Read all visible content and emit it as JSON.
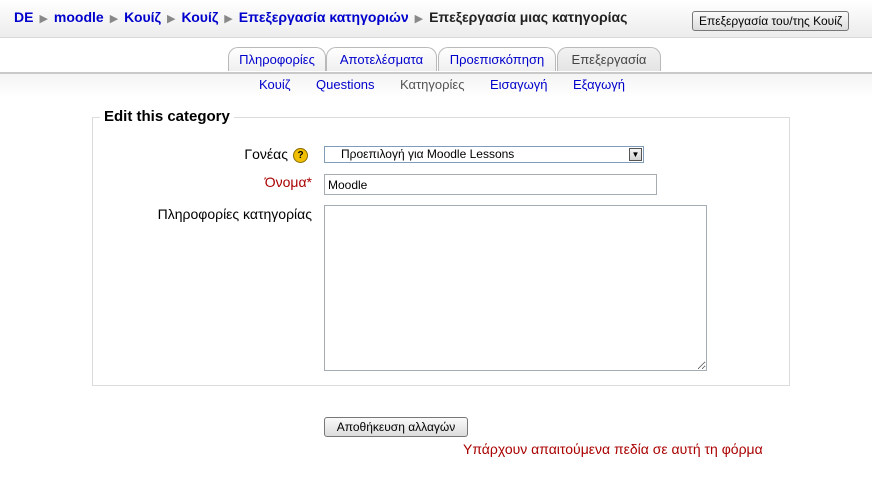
{
  "breadcrumb": {
    "items": [
      "DE",
      "moodle",
      "Κουίζ",
      "Κουίζ",
      "Επεξεργασία κατηγοριών"
    ],
    "current": "Επεξεργασία μιας κατηγορίας"
  },
  "header": {
    "edit_quiz_button": "Επεξεργασία του/της Κουίζ"
  },
  "tabs": [
    {
      "label": "Πληροφορίες"
    },
    {
      "label": "Αποτελέσματα"
    },
    {
      "label": "Προεπισκόπηση"
    },
    {
      "label": "Επεξεργασία",
      "selected": true
    }
  ],
  "subtabs": [
    {
      "label": "Κουίζ"
    },
    {
      "label": "Questions"
    },
    {
      "label": "Κατηγορίες",
      "selected": true
    },
    {
      "label": "Εισαγωγή"
    },
    {
      "label": "Εξαγωγή"
    }
  ],
  "form": {
    "legend": "Edit this category",
    "parent_label": "Γονέας",
    "parent_value": "Προεπιλογή για Moodle Lessons",
    "name_label": "Όνομα*",
    "name_value": "Moodle",
    "info_label": "Πληροφορίες κατηγορίας",
    "info_value": "",
    "save_button": "Αποθήκευση αλλαγών",
    "required_note": "Υπάρχουν απαιτούμενα πεδία σε αυτή τη φόρμα"
  },
  "colors": {
    "link": "#0000cc",
    "required": "#aa0000"
  }
}
